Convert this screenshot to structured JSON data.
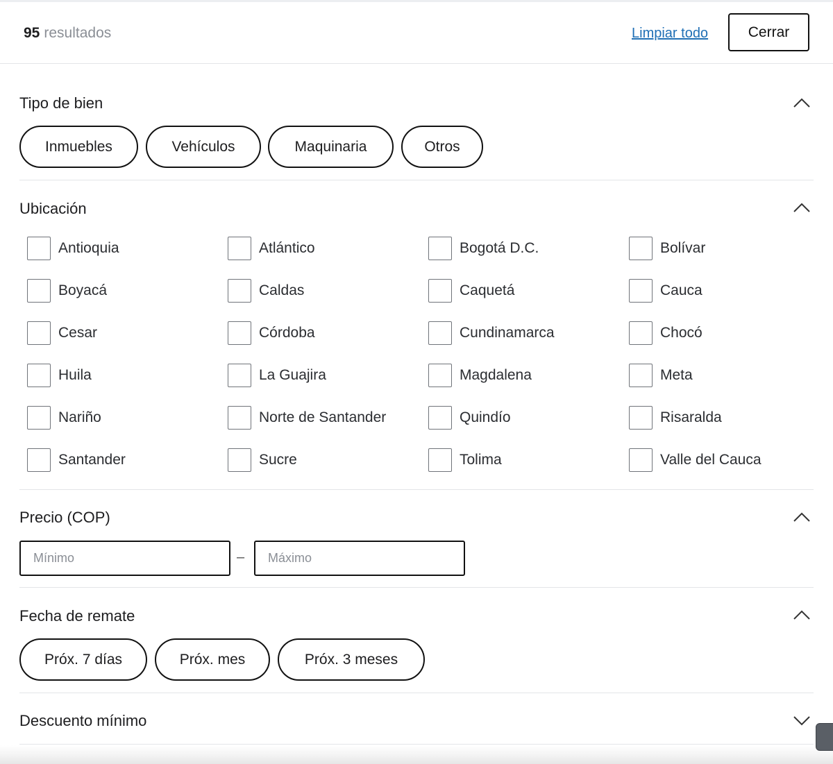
{
  "header": {
    "result_count": "95",
    "result_label": "resultados",
    "clear_all": "Limpiar todo",
    "close": "Cerrar"
  },
  "sections": {
    "tipo": {
      "title": "Tipo de bien",
      "options": [
        "Inmuebles",
        "Vehículos",
        "Maquinaria",
        "Otros"
      ],
      "expanded": true
    },
    "ubicacion": {
      "title": "Ubicación",
      "expanded": true,
      "options": [
        "Antioquia",
        "Atlántico",
        "Bogotá D.C.",
        "Bolívar",
        "Boyacá",
        "Caldas",
        "Caquetá",
        "Cauca",
        "Cesar",
        "Córdoba",
        "Cundinamarca",
        "Chocó",
        "Huila",
        "La Guajira",
        "Magdalena",
        "Meta",
        "Nariño",
        "Norte de Santander",
        "Quindío",
        "Risaralda",
        "Santander",
        "Sucre",
        "Tolima",
        "Valle del Cauca"
      ]
    },
    "precio": {
      "title": "Precio (COP)",
      "expanded": true,
      "min_placeholder": "Mínimo",
      "max_placeholder": "Máximo",
      "separator": "–"
    },
    "fecha": {
      "title": "Fecha de remate",
      "expanded": true,
      "options": [
        "Próx. 7 días",
        "Próx. mes",
        "Próx. 3 meses"
      ]
    },
    "descuento": {
      "title": "Descuento mínimo",
      "expanded": false
    }
  }
}
